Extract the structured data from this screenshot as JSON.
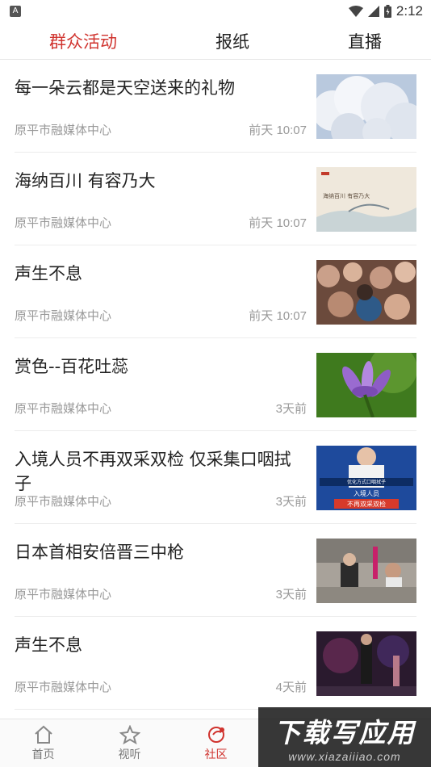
{
  "status_bar": {
    "app_icon_letter": "A",
    "time": "2:12"
  },
  "tabs": [
    {
      "label": "群众活动",
      "active": true
    },
    {
      "label": "报纸",
      "active": false
    },
    {
      "label": "直播",
      "active": false
    }
  ],
  "colors": {
    "accent": "#d0332e",
    "meta_text": "#999999",
    "title_text": "#222222"
  },
  "articles": [
    {
      "title": "每一朵云都是天空送来的礼物",
      "source": "原平市融媒体中心",
      "time": "前天 10:07",
      "thumb": "clouds"
    },
    {
      "title": "海纳百川  有容乃大",
      "source": "原平市融媒体中心",
      "time": "前天 10:07",
      "thumb": "calligraphy"
    },
    {
      "title": "声生不息",
      "source": "原平市融媒体中心",
      "time": "前天 10:07",
      "thumb": "crowd"
    },
    {
      "title": "赏色--百花吐蕊",
      "source": "原平市融媒体中心",
      "time": "3天前",
      "thumb": "flower"
    },
    {
      "title": "入境人员不再双采双检  仅采集口咽拭子",
      "source": "原平市融媒体中心",
      "time": "3天前",
      "thumb": "news"
    },
    {
      "title": "日本首相安倍晋三中枪",
      "source": "原平市融媒体中心",
      "time": "3天前",
      "thumb": "street"
    },
    {
      "title": "声生不息",
      "source": "原平市融媒体中心",
      "time": "4天前",
      "thumb": "stage"
    }
  ],
  "thumb_text": {
    "calligraphy": "海纳百川 有容乃大",
    "news_top": "优化方式口咽拭子",
    "news_line1": "入境人员",
    "news_line2": "不再双采双检"
  },
  "bottom_nav": [
    {
      "label": "首页",
      "icon": "home-icon",
      "active": false
    },
    {
      "label": "视听",
      "icon": "star-icon",
      "active": false
    },
    {
      "label": "社区",
      "icon": "community-icon",
      "active": true
    }
  ],
  "watermark": {
    "main": "下载写应用",
    "sub": "www.xiazaiiiao.com"
  }
}
